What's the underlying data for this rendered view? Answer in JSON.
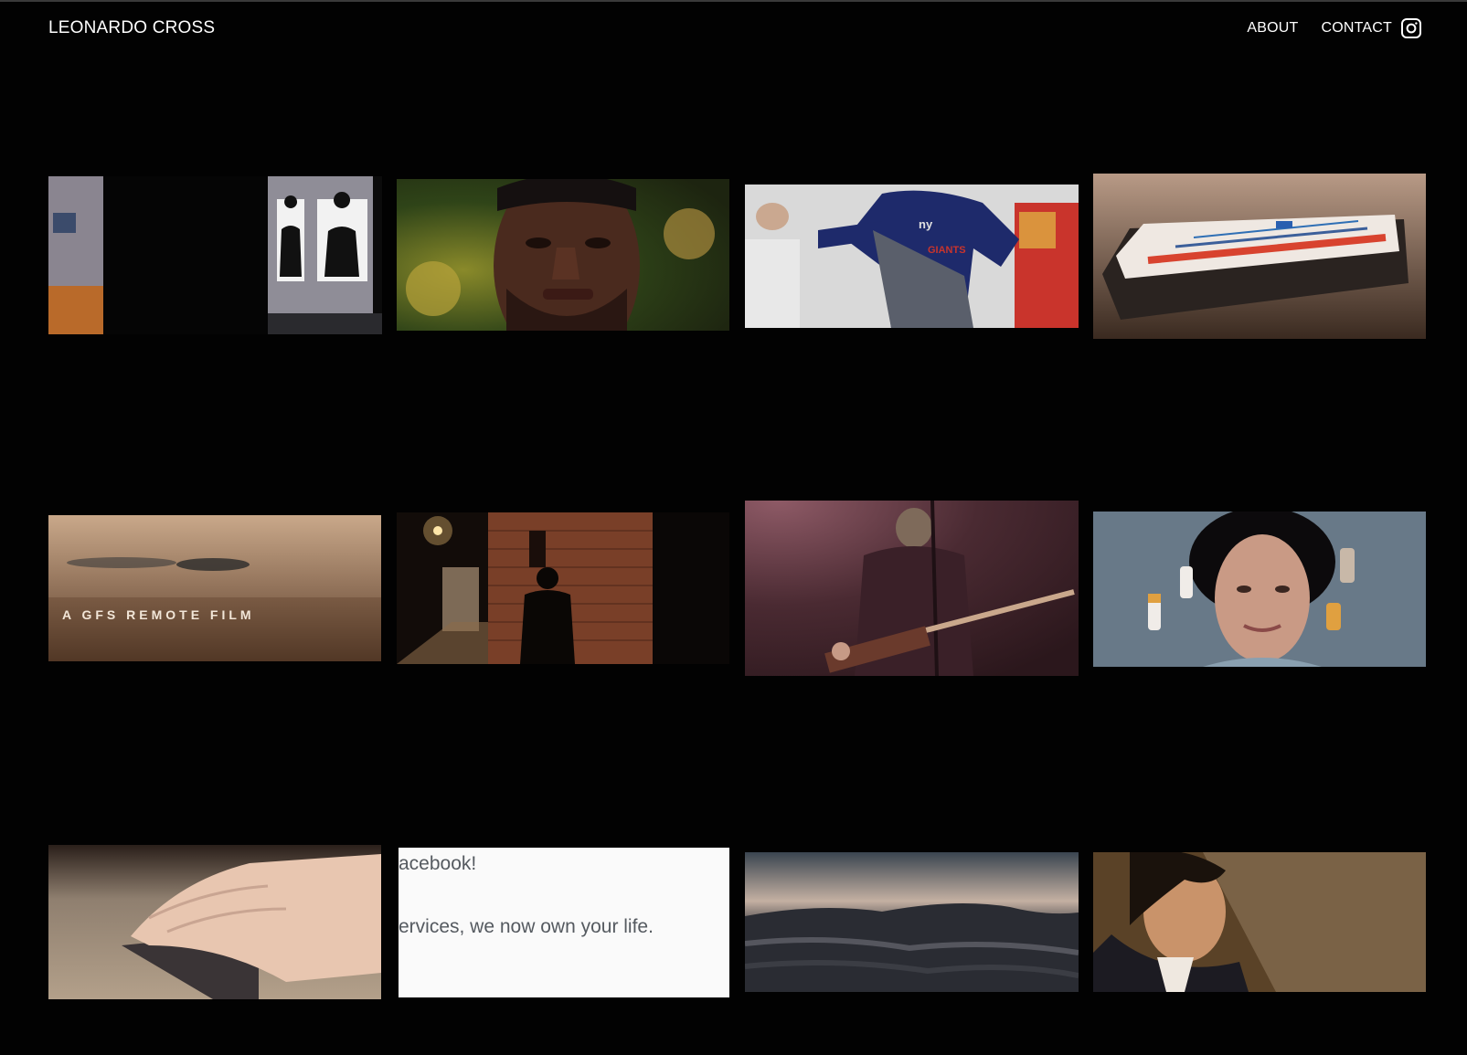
{
  "header": {
    "brand": "LEONARDO CROSS",
    "nav": [
      "ABOUT",
      "CONTACT"
    ],
    "social_icon": "instagram-icon"
  },
  "gallery": {
    "items": [
      {
        "label": "shooting-range-targets"
      },
      {
        "label": "portrait-young-man-outdoors"
      },
      {
        "label": "low-angle-giants-sweatshirt"
      },
      {
        "label": "free-pizza-box"
      },
      {
        "label": "gfs-remote-film-title",
        "overlay_text": "A GFS REMOTE FILM"
      },
      {
        "label": "night-alley-silhouette"
      },
      {
        "label": "bass-player-on-stage"
      },
      {
        "label": "curly-hair-man-lying-with-pills"
      },
      {
        "label": "hand-on-card"
      },
      {
        "label": "facebook-message",
        "line1": "acebook!",
        "line2": "ervices, we now own your life."
      },
      {
        "label": "ocean-waves-dusk"
      },
      {
        "label": "young-man-looking-up"
      }
    ]
  }
}
